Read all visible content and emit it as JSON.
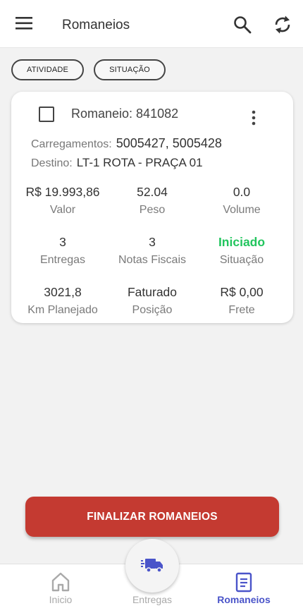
{
  "header": {
    "title": "Romaneios",
    "menu_icon": "menu-icon",
    "search_icon": "search-icon",
    "sync_icon": "sync-icon"
  },
  "filters": [
    {
      "label": "ATIVIDADE"
    },
    {
      "label": "SITUAÇÃO"
    }
  ],
  "card": {
    "title": "Romaneio: 841082",
    "carregamentos_label": "Carregamentos:",
    "carregamentos_value": "5005427, 5005428",
    "destino_label": "Destino:",
    "destino_value": "LT-1 ROTA - PRAÇA 01",
    "stats": [
      {
        "value": "R$ 19.993,86",
        "label": "Valor"
      },
      {
        "value": "52.04",
        "label": "Peso"
      },
      {
        "value": "0.0",
        "label": "Volume"
      },
      {
        "value": "3",
        "label": "Entregas"
      },
      {
        "value": "3",
        "label": "Notas Fiscais"
      },
      {
        "value": "Iniciado",
        "label": "Situação"
      },
      {
        "value": "3021,8",
        "label": "Km Planejado"
      },
      {
        "value": "Faturado",
        "label": "Posição"
      },
      {
        "value": "R$ 0,00",
        "label": "Frete"
      }
    ]
  },
  "actions": {
    "finalize_label": "FINALIZAR ROMANEIOS"
  },
  "bottom_nav": {
    "items": [
      {
        "label": "Inicio",
        "icon": "home-icon"
      },
      {
        "label": "Entregas",
        "icon": "truck-icon"
      },
      {
        "label": "Romaneios",
        "icon": "document-icon",
        "active": true
      }
    ]
  },
  "colors": {
    "accent": "#4a54c9",
    "danger": "#c43a31",
    "status_green": "#22c55e"
  }
}
